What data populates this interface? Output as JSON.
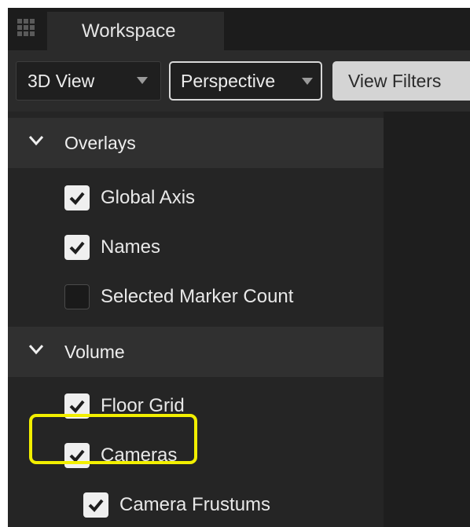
{
  "tabbar": {
    "tab_label": "Workspace"
  },
  "toolbar": {
    "view_dropdown": "3D View",
    "projection_dropdown": "Perspective",
    "filters_button": "View Filters"
  },
  "sections": {
    "overlays": {
      "title": "Overlays",
      "items": [
        {
          "label": "Global Axis",
          "checked": true
        },
        {
          "label": "Names",
          "checked": true
        },
        {
          "label": "Selected Marker Count",
          "checked": false
        }
      ]
    },
    "volume": {
      "title": "Volume",
      "items": [
        {
          "label": "Floor Grid",
          "checked": true
        },
        {
          "label": "Cameras",
          "checked": true
        },
        {
          "label": "Camera Frustums",
          "checked": true
        }
      ]
    }
  },
  "colors": {
    "highlight": "#f2ef00",
    "panel_bg": "#252525",
    "header_bg": "#303030"
  }
}
